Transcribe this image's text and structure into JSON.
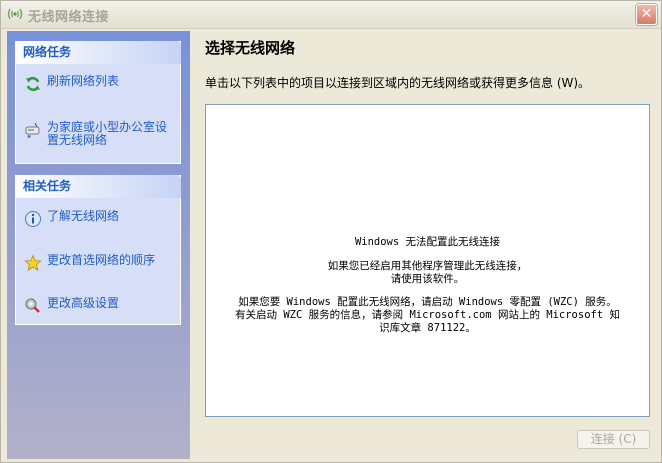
{
  "window": {
    "title": "无线网络连接",
    "close_label": "✕"
  },
  "task_pane": {
    "network_tasks": {
      "header": "网络任务",
      "items": [
        {
          "label": "刷新网络列表",
          "icon": "refresh-icon"
        },
        {
          "label": "为家庭或小型办公室设置无线网络",
          "icon": "setup-network-icon"
        }
      ]
    },
    "related_tasks": {
      "header": "相关任务",
      "items": [
        {
          "label": "了解无线网络",
          "icon": "info-icon"
        },
        {
          "label": "更改首选网络的顺序",
          "icon": "star-icon"
        },
        {
          "label": "更改高级设置",
          "icon": "settings-icon"
        }
      ]
    }
  },
  "main": {
    "heading": "选择无线网络",
    "instruction": "单击以下列表中的项目以连接到区域内的无线网络或获得更多信息 (W)。",
    "message": {
      "line1": "Windows 无法配置此无线连接",
      "line2": "如果您已经启用其他程序管理此无线连接，",
      "line3": "请使用该软件。",
      "line4": "如果您要 Windows 配置此无线网络，请启动 Windows 零配置 (WZC) 服务。",
      "line5": "有关启动 WZC 服务的信息，请参阅 Microsoft.com 网站上的 Microsoft 知",
      "line6": "识库文章 871122。"
    },
    "connect_button": "连接 (C)"
  }
}
